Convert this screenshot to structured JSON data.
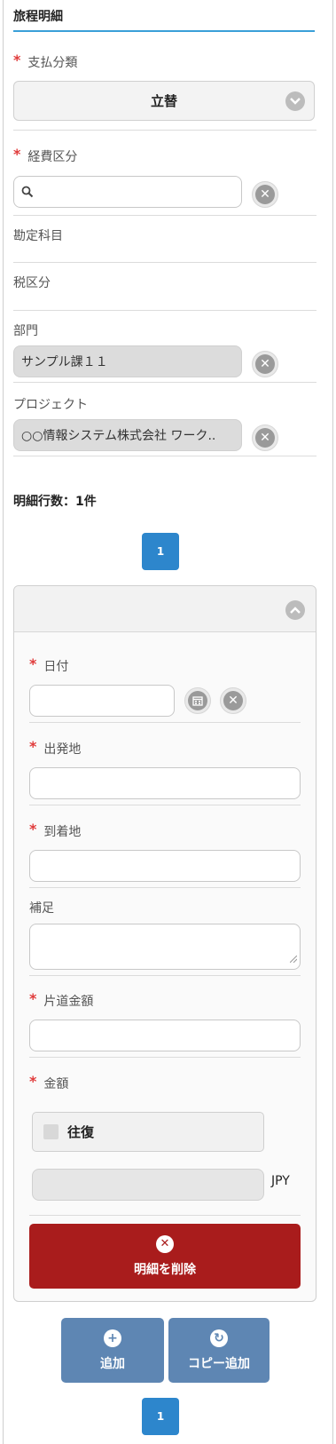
{
  "section": {
    "title": "旅程明細"
  },
  "payment": {
    "label": "支払分類",
    "value": "立替"
  },
  "expense": {
    "label": "経費区分",
    "value": ""
  },
  "account": {
    "label": "勘定科目"
  },
  "tax": {
    "label": "税区分"
  },
  "department": {
    "label": "部門",
    "value": "サンプル課１１"
  },
  "project": {
    "label": "プロジェクト",
    "value": "○○情報システム株式会社 ワーク.."
  },
  "detail_count": {
    "text": "明細行数：1件"
  },
  "pagination_top": {
    "page": "1"
  },
  "detail": {
    "date": {
      "label": "日付",
      "value": ""
    },
    "departure": {
      "label": "出発地",
      "value": ""
    },
    "arrival": {
      "label": "到着地",
      "value": ""
    },
    "note": {
      "label": "補足",
      "value": ""
    },
    "one_way": {
      "label": "片道金額",
      "value": ""
    },
    "amount": {
      "label": "金額",
      "round_trip_label": "往復",
      "value": "",
      "currency": "JPY"
    },
    "delete_label": "明細を削除"
  },
  "actions": {
    "add_label": "追加",
    "copy_add_label": "コピー追加"
  },
  "pagination_bottom": {
    "page": "1"
  },
  "colors": {
    "accent": "#2d86cc",
    "danger": "#a91c1c",
    "action": "#5e86b3",
    "required": "#e03a3a"
  }
}
